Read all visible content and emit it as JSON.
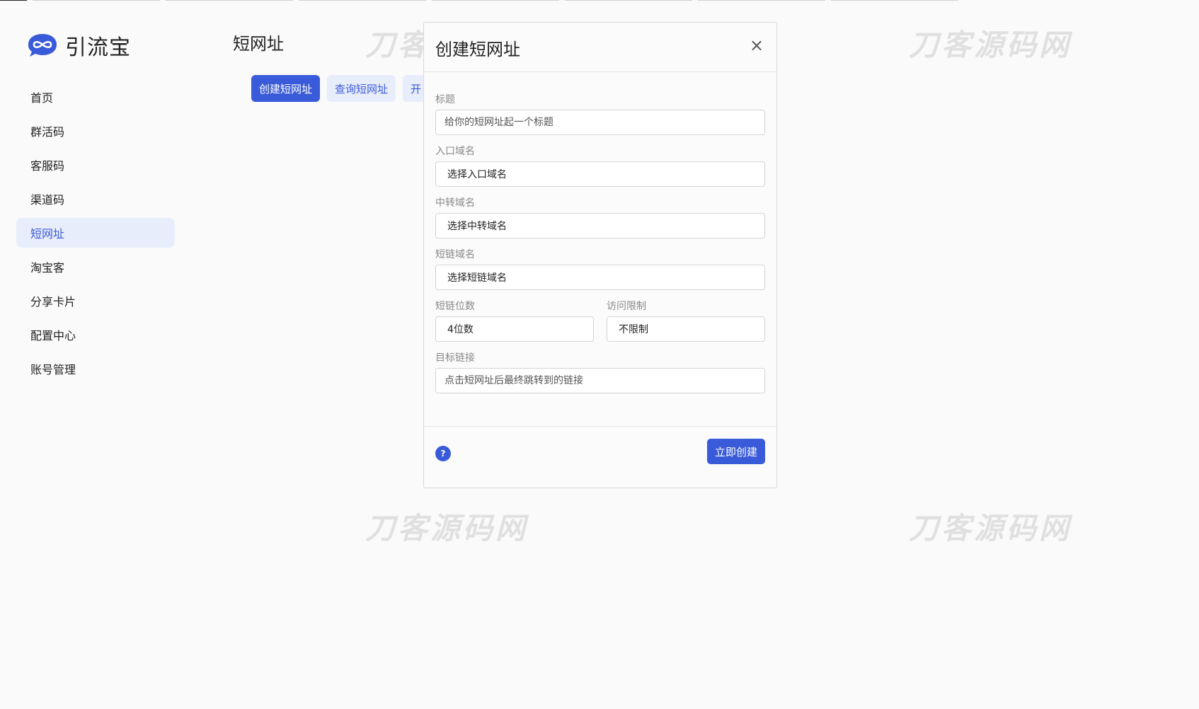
{
  "brand": {
    "name": "引流宝",
    "logo_icon": "infinity-bubble-icon",
    "accent": "#3a5bd9"
  },
  "sidebar": {
    "items": [
      {
        "label": "首页",
        "active": false
      },
      {
        "label": "群活码",
        "active": false
      },
      {
        "label": "客服码",
        "active": false
      },
      {
        "label": "渠道码",
        "active": false
      },
      {
        "label": "短网址",
        "active": true
      },
      {
        "label": "淘宝客",
        "active": false
      },
      {
        "label": "分享卡片",
        "active": false
      },
      {
        "label": "配置中心",
        "active": false
      },
      {
        "label": "账号管理",
        "active": false
      }
    ]
  },
  "main": {
    "title": "短网址",
    "tabs": [
      {
        "label": "创建短网址"
      },
      {
        "label": "查询短网址"
      },
      {
        "label": "开"
      }
    ]
  },
  "watermark": {
    "text": "刀客源码网"
  },
  "modal": {
    "title": "创建短网址",
    "close_icon": "close-icon",
    "fields": {
      "title": {
        "label": "标题",
        "placeholder": "给你的短网址起一个标题"
      },
      "entry_domain": {
        "label": "入口域名",
        "value": "选择入口域名"
      },
      "relay_domain": {
        "label": "中转域名",
        "value": "选择中转域名"
      },
      "short_domain": {
        "label": "短链域名",
        "value": "选择短链域名"
      },
      "short_length": {
        "label": "短链位数",
        "value": "4位数"
      },
      "access_limit": {
        "label": "访问限制",
        "value": "不限制"
      },
      "target_url": {
        "label": "目标链接",
        "placeholder": "点击短网址后最终跳转到的链接"
      }
    },
    "help_icon": "question-icon",
    "help_glyph": "?",
    "submit_label": "立即创建"
  }
}
